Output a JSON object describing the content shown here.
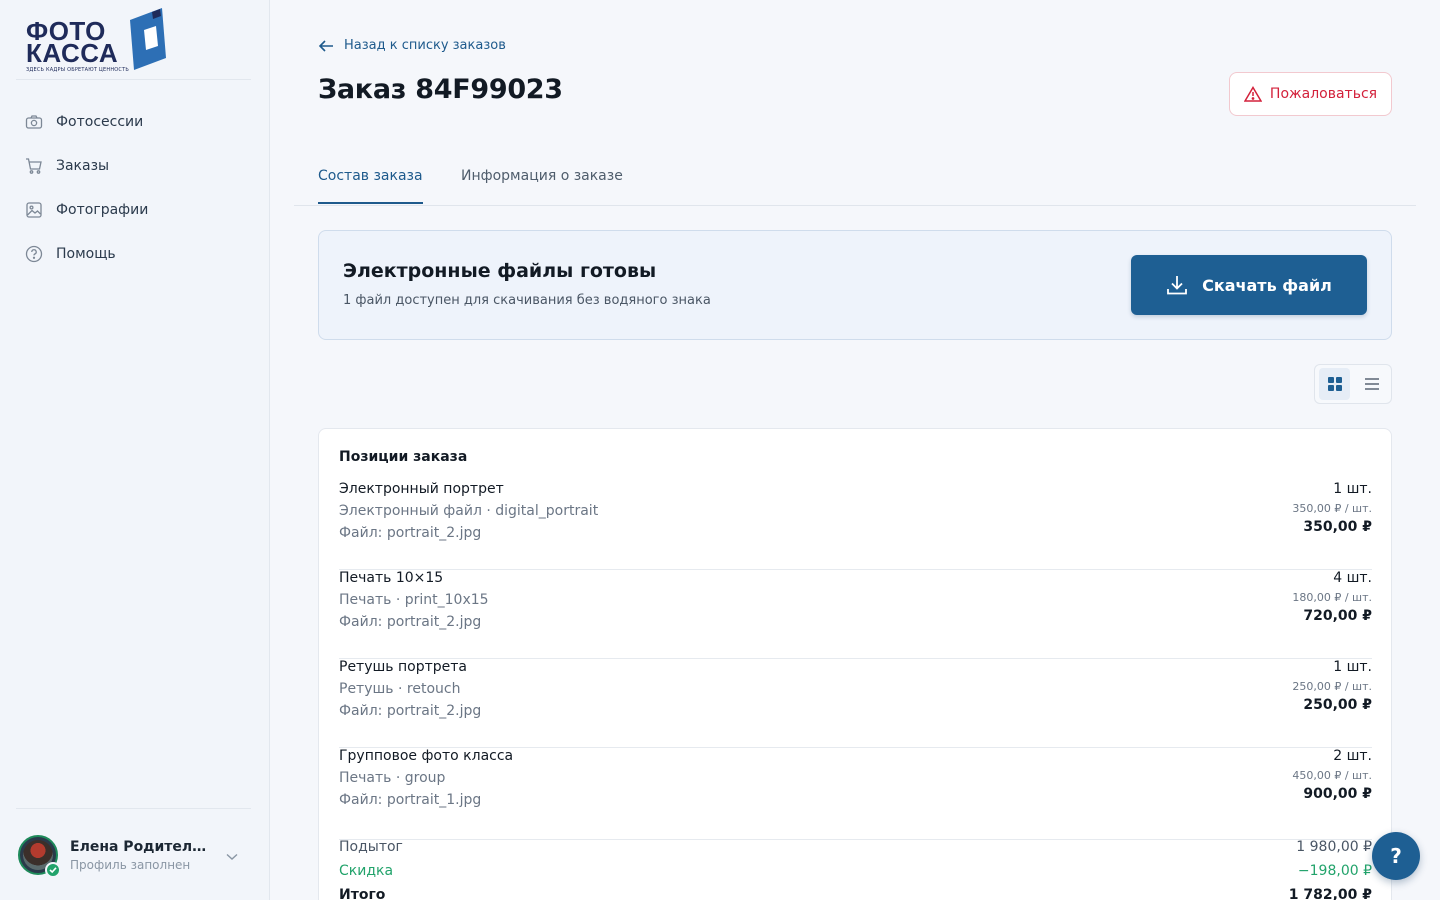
{
  "brand": {
    "line1": "ФОТО",
    "line2": "КАССА",
    "tagline": "ЗДЕСЬ КАДРЫ ОБРЕТАЮТ ЦЕННОСТЬ"
  },
  "sidebar": {
    "items": [
      {
        "label": "Фотосессии",
        "icon": "camera-icon"
      },
      {
        "label": "Заказы",
        "icon": "cart-icon"
      },
      {
        "label": "Фотографии",
        "icon": "image-icon"
      },
      {
        "label": "Помощь",
        "icon": "help-circle-icon"
      }
    ]
  },
  "user": {
    "name": "Елена Родительская",
    "status": "Профиль заполнен"
  },
  "header": {
    "back_label": "Назад к списку заказов",
    "title": "Заказ 84F99023",
    "complain_label": "Пожаловаться"
  },
  "tabs": [
    {
      "label": "Состав заказа",
      "active": true
    },
    {
      "label": "Информация о заказе",
      "active": false
    }
  ],
  "ready_banner": {
    "title": "Электронные файлы готовы",
    "subtitle": "1 файл доступен для скачивания без водяного знака",
    "button_label": "Скачать файл"
  },
  "order": {
    "title": "Позиции заказа",
    "items": [
      {
        "name": "Электронный портрет",
        "type": "Электронный файл · digital_portrait",
        "file": "Файл: portrait_2.jpg",
        "qty": "1 шт.",
        "unit": "350,00 ₽ / шт.",
        "total": "350,00 ₽"
      },
      {
        "name": "Печать 10×15",
        "type": "Печать · print_10x15",
        "file": "Файл: portrait_2.jpg",
        "qty": "4 шт.",
        "unit": "180,00 ₽ / шт.",
        "total": "720,00 ₽"
      },
      {
        "name": "Ретушь портрета",
        "type": "Ретушь · retouch",
        "file": "Файл: portrait_2.jpg",
        "qty": "1 шт.",
        "unit": "250,00 ₽ / шт.",
        "total": "250,00 ₽"
      },
      {
        "name": "Групповое фото класса",
        "type": "Печать · group",
        "file": "Файл: portrait_1.jpg",
        "qty": "2 шт.",
        "unit": "450,00 ₽ / шт.",
        "total": "900,00 ₽"
      }
    ],
    "summary": {
      "subtotal_label": "Подытог",
      "subtotal_value": "1 980,00 ₽",
      "discount_label": "Скидка",
      "discount_value": "−198,00 ₽",
      "total_label": "Итого",
      "total_value": "1 782,00 ₽"
    }
  },
  "help_button": "?",
  "colors": {
    "accent": "#1e5f93",
    "danger": "#d3213b",
    "success": "#22a36b"
  }
}
